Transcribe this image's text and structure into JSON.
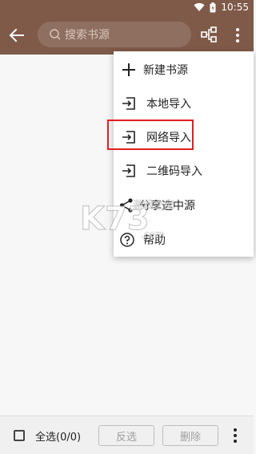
{
  "status_bar": {
    "time": "10:55"
  },
  "toolbar": {
    "search_placeholder": "搜索书源"
  },
  "menu": {
    "items": [
      {
        "label": "新建书源",
        "icon": "plus-icon"
      },
      {
        "label": "本地导入",
        "icon": "import-icon"
      },
      {
        "label": "网络导入",
        "icon": "import-icon"
      },
      {
        "label": "二维码导入",
        "icon": "import-icon"
      },
      {
        "label": "分享选中源",
        "icon": "share-icon"
      },
      {
        "label": "帮助",
        "icon": "help-icon"
      }
    ]
  },
  "watermark": {
    "brand": "K73",
    "site": "游戏之家",
    "url": ".com"
  },
  "bottom_bar": {
    "select_all_label": "全选(0/0)",
    "invert_label": "反选",
    "delete_label": "删除"
  },
  "colors": {
    "appbar": "#7f5a49",
    "highlight": "#e31e24"
  }
}
